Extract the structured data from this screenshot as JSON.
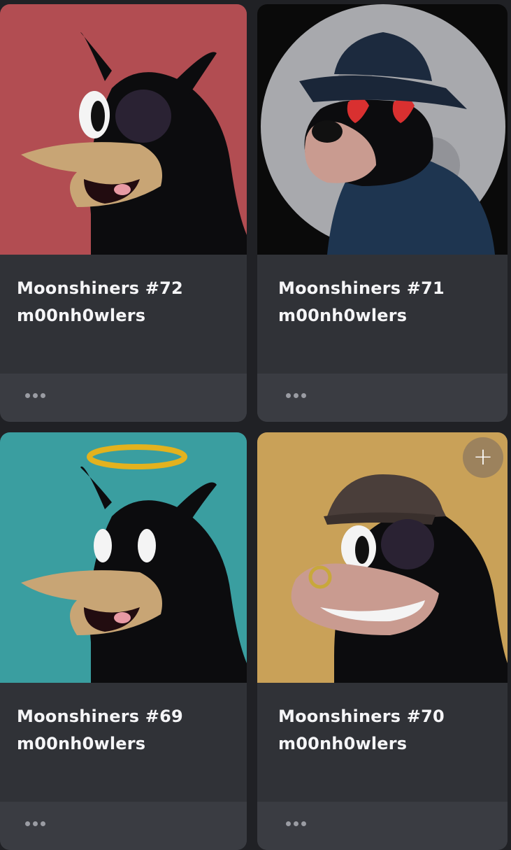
{
  "cards": [
    {
      "title": "Moonshiners #72",
      "collection": "m00nh0wlers",
      "background": "#b24d52",
      "character": "duck-beak-cat with one eye and eyepatch"
    },
    {
      "title": "Moonshiners #71",
      "collection": "m00nh0wlers",
      "background": "#0a0a0a",
      "character": "wolf with fedora, heart eyes, moon background"
    },
    {
      "title": "Moonshiners #69",
      "collection": "m00nh0wlers",
      "background": "#3a9ea0",
      "character": "duck-beak-cat with halo"
    },
    {
      "title": "Moonshiners #70",
      "collection": "m00nh0wlers",
      "background": "#c9a158",
      "character": "wolf with flat cap and nose ring"
    }
  ],
  "actions": {
    "add_label": "+"
  },
  "icons": {
    "more": "more-dots-icon",
    "add": "plus-icon"
  }
}
